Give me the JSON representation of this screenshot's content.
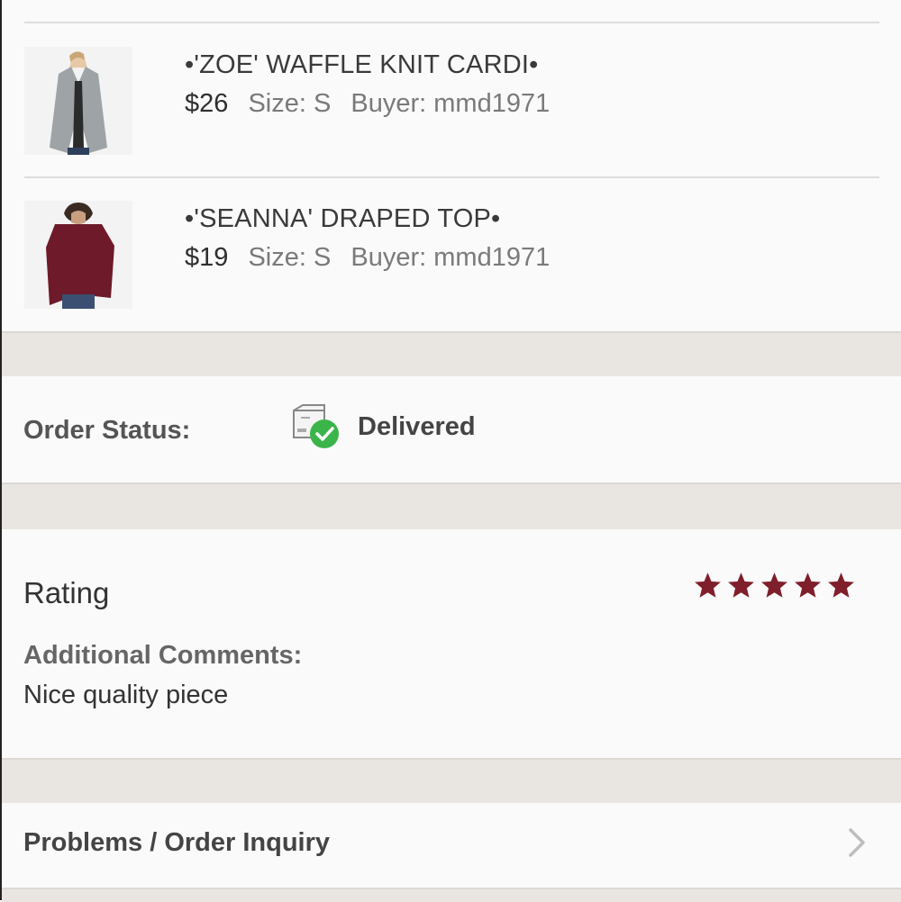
{
  "order_items": [
    {
      "title": "•'ZOE' WAFFLE KNIT CARDI•",
      "price": "$26",
      "size": "Size: S",
      "buyer": "Buyer: mmd1971",
      "thumbnail": "cardigan-photo"
    },
    {
      "title": "•'SEANNA' DRAPED TOP•",
      "price": "$19",
      "size": "Size: S",
      "buyer": "Buyer: mmd1971",
      "thumbnail": "draped-top-photo"
    }
  ],
  "order_status": {
    "label": "Order Status:",
    "value": "Delivered",
    "icon": "package-delivered-icon",
    "icon_color": "#3bb54a"
  },
  "rating": {
    "label": "Rating",
    "stars": 5,
    "max_stars": 5,
    "star_color": "#7f1f2b",
    "comments_label": "Additional Comments:",
    "comments": "Nice quality piece"
  },
  "inquiry": {
    "label": "Problems / Order Inquiry",
    "icon": "chevron-right-icon"
  }
}
